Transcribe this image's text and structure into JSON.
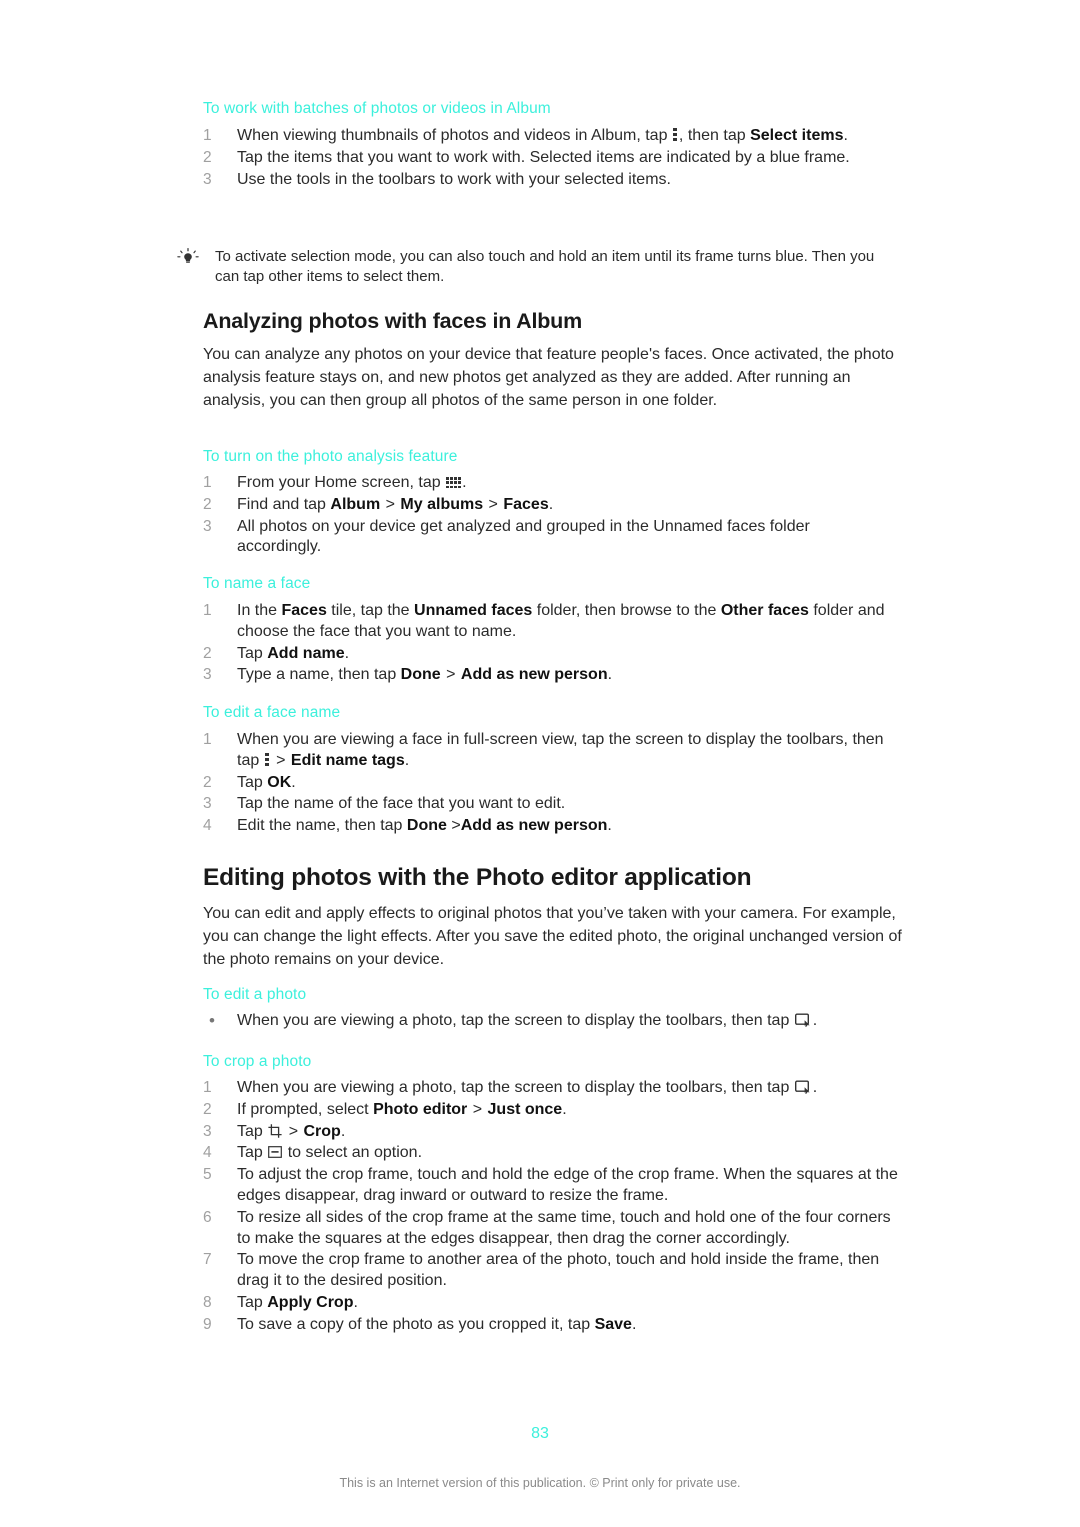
{
  "document": {
    "page_number": "83",
    "footer_note": "This is an Internet version of this publication. © Print only for private use."
  },
  "sections": {
    "batches": {
      "heading": "To work with batches of photos or videos in Album",
      "steps": [
        {
          "num": "1",
          "parts": [
            {
              "t": "text",
              "v": "When viewing thumbnails of photos and videos in Album, tap "
            },
            {
              "t": "icon",
              "v": "more-options-dots-icon"
            },
            {
              "t": "text",
              "v": ", then tap "
            },
            {
              "t": "bold",
              "v": "Select items"
            },
            {
              "t": "text",
              "v": "."
            }
          ]
        },
        {
          "num": "2",
          "parts": [
            {
              "t": "text",
              "v": "Tap the items that you want to work with. Selected items are indicated by a blue frame."
            }
          ]
        },
        {
          "num": "3",
          "parts": [
            {
              "t": "text",
              "v": "Use the tools in the toolbars to work with your selected items."
            }
          ]
        }
      ],
      "tip": "To activate selection mode, you can also touch and hold an item until its frame turns blue. Then you can tap other items to select them."
    },
    "analyzing": {
      "heading": "Analyzing photos with faces in Album",
      "intro": "You can analyze any photos on your device that feature people's faces. Once activated, the photo analysis feature stays on, and new photos get analyzed as they are added. After running an analysis, you can then group all photos of the same person in one folder.",
      "turn_on": {
        "heading": "To turn on the photo analysis feature",
        "steps": [
          {
            "num": "1",
            "parts": [
              {
                "t": "text",
                "v": "From your Home screen, tap "
              },
              {
                "t": "icon",
                "v": "app-drawer-grid-icon"
              },
              {
                "t": "text",
                "v": "."
              }
            ]
          },
          {
            "num": "2",
            "parts": [
              {
                "t": "text",
                "v": "Find and tap "
              },
              {
                "t": "bold",
                "v": "Album"
              },
              {
                "t": "gt",
                "v": ">"
              },
              {
                "t": "bold",
                "v": "My albums"
              },
              {
                "t": "gt",
                "v": ">"
              },
              {
                "t": "bold",
                "v": "Faces"
              },
              {
                "t": "text",
                "v": "."
              }
            ]
          },
          {
            "num": "3",
            "parts": [
              {
                "t": "text",
                "v": "All photos on your device get analyzed and grouped in the Unnamed faces folder accordingly."
              }
            ]
          }
        ]
      },
      "name_face": {
        "heading": "To name a face",
        "steps": [
          {
            "num": "1",
            "parts": [
              {
                "t": "text",
                "v": "In the "
              },
              {
                "t": "bold",
                "v": "Faces"
              },
              {
                "t": "text",
                "v": " tile, tap the "
              },
              {
                "t": "bold",
                "v": "Unnamed faces"
              },
              {
                "t": "text",
                "v": " folder, then browse to the "
              },
              {
                "t": "bold",
                "v": "Other faces"
              },
              {
                "t": "text",
                "v": " folder and choose the face that you want to name."
              }
            ]
          },
          {
            "num": "2",
            "parts": [
              {
                "t": "text",
                "v": "Tap "
              },
              {
                "t": "bold",
                "v": "Add name"
              },
              {
                "t": "text",
                "v": "."
              }
            ]
          },
          {
            "num": "3",
            "parts": [
              {
                "t": "text",
                "v": "Type a name, then tap "
              },
              {
                "t": "bold",
                "v": "Done"
              },
              {
                "t": "gt",
                "v": ">"
              },
              {
                "t": "bold",
                "v": "Add as new person"
              },
              {
                "t": "text",
                "v": "."
              }
            ]
          }
        ]
      },
      "edit_face_name": {
        "heading": "To edit a face name",
        "steps": [
          {
            "num": "1",
            "parts": [
              {
                "t": "text",
                "v": "When you are viewing a face in full-screen view, tap the screen to display the toolbars, then tap "
              },
              {
                "t": "icon",
                "v": "more-options-dots-icon"
              },
              {
                "t": "gt",
                "v": ">"
              },
              {
                "t": "bold",
                "v": "Edit name tags"
              },
              {
                "t": "text",
                "v": "."
              }
            ]
          },
          {
            "num": "2",
            "parts": [
              {
                "t": "text",
                "v": "Tap "
              },
              {
                "t": "bold",
                "v": "OK"
              },
              {
                "t": "text",
                "v": "."
              }
            ]
          },
          {
            "num": "3",
            "parts": [
              {
                "t": "text",
                "v": "Tap the name of the face that you want to edit."
              }
            ]
          },
          {
            "num": "4",
            "parts": [
              {
                "t": "text",
                "v": "Edit the name, then tap "
              },
              {
                "t": "bold",
                "v": "Done"
              },
              {
                "t": "text",
                "v": " >"
              },
              {
                "t": "bold",
                "v": "Add as new person"
              },
              {
                "t": "text",
                "v": "."
              }
            ]
          }
        ]
      }
    },
    "editing": {
      "heading": "Editing photos with the Photo editor application",
      "intro": "You can edit and apply effects to original photos that you’ve taken with your camera. For example, you can change the light effects. After you save the edited photo, the original unchanged version of the photo remains on your device.",
      "edit_photo": {
        "heading": "To edit a photo",
        "steps": [
          {
            "num": "•",
            "parts": [
              {
                "t": "text",
                "v": "When you are viewing a photo, tap the screen to display the toolbars, then tap "
              },
              {
                "t": "icon",
                "v": "photo-editor-icon"
              },
              {
                "t": "text",
                "v": "."
              }
            ]
          }
        ]
      },
      "crop_photo": {
        "heading": "To crop a photo",
        "steps": [
          {
            "num": "1",
            "parts": [
              {
                "t": "text",
                "v": "When you are viewing a photo, tap the screen to display the toolbars, then tap "
              },
              {
                "t": "icon",
                "v": "photo-editor-icon"
              },
              {
                "t": "text",
                "v": "."
              }
            ]
          },
          {
            "num": "2",
            "parts": [
              {
                "t": "text",
                "v": "If prompted, select "
              },
              {
                "t": "bold",
                "v": "Photo editor"
              },
              {
                "t": "gt",
                "v": ">"
              },
              {
                "t": "bold",
                "v": "Just once"
              },
              {
                "t": "text",
                "v": "."
              }
            ]
          },
          {
            "num": "3",
            "parts": [
              {
                "t": "text",
                "v": "Tap "
              },
              {
                "t": "icon",
                "v": "crop-tool-icon"
              },
              {
                "t": "gt",
                "v": ">"
              },
              {
                "t": "bold",
                "v": "Crop"
              },
              {
                "t": "text",
                "v": "."
              }
            ]
          },
          {
            "num": "4",
            "parts": [
              {
                "t": "text",
                "v": "Tap "
              },
              {
                "t": "icon",
                "v": "option-rectangle-icon"
              },
              {
                "t": "text",
                "v": " to select an option."
              }
            ]
          },
          {
            "num": "5",
            "parts": [
              {
                "t": "text",
                "v": "To adjust the crop frame, touch and hold the edge of the crop frame. When the squares at the edges disappear, drag inward or outward to resize the frame."
              }
            ]
          },
          {
            "num": "6",
            "parts": [
              {
                "t": "text",
                "v": "To resize all sides of the crop frame at the same time, touch and hold one of the four corners to make the squares at the edges disappear, then drag the corner accordingly."
              }
            ]
          },
          {
            "num": "7",
            "parts": [
              {
                "t": "text",
                "v": "To move the crop frame to another area of the photo, touch and hold inside the frame, then drag it to the desired position."
              }
            ]
          },
          {
            "num": "8",
            "parts": [
              {
                "t": "text",
                "v": "Tap "
              },
              {
                "t": "bold",
                "v": "Apply Crop"
              },
              {
                "t": "text",
                "v": "."
              }
            ]
          },
          {
            "num": "9",
            "parts": [
              {
                "t": "text",
                "v": "To save a copy of the photo as you cropped it, tap "
              },
              {
                "t": "bold",
                "v": "Save"
              },
              {
                "t": "text",
                "v": "."
              }
            ]
          }
        ]
      }
    }
  },
  "colors": {
    "heading_accent": "#3cf0dc",
    "body_text": "#2b2b2b",
    "list_number": "#a0a0a0",
    "footer_text": "#8a8a8a"
  }
}
